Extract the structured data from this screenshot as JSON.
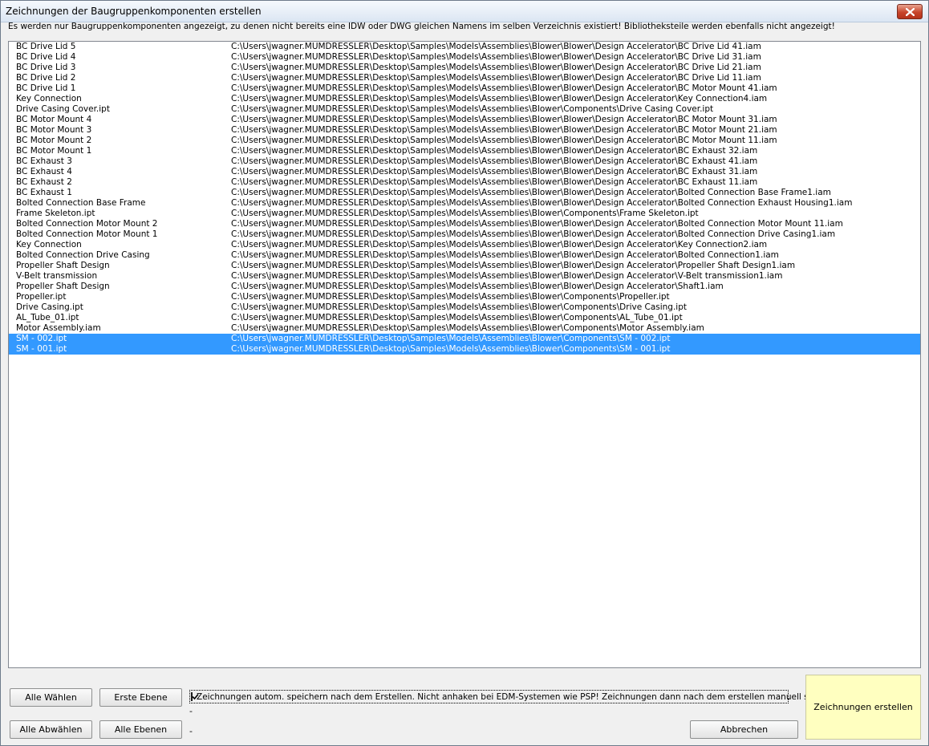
{
  "window": {
    "title": "Zeichnungen der Baugruppenkomponenten erstellen",
    "info": "Es werden nur Baugruppenkomponenten angezeigt, zu denen nicht bereits eine IDW oder DWG gleichen Namens im selben Verzeichnis existiert! Bibliotheksteile werden ebenfalls nicht angezeigt!"
  },
  "list": {
    "rows": [
      {
        "name": "BC Drive Lid 5",
        "path": "C:\\Users\\jwagner.MUMDRESSLER\\Desktop\\Samples\\Models\\Assemblies\\Blower\\Blower\\Design Accelerator\\BC Drive Lid 41.iam",
        "selected": false
      },
      {
        "name": "BC Drive Lid 4",
        "path": "C:\\Users\\jwagner.MUMDRESSLER\\Desktop\\Samples\\Models\\Assemblies\\Blower\\Blower\\Design Accelerator\\BC Drive Lid 31.iam",
        "selected": false
      },
      {
        "name": "BC Drive Lid 3",
        "path": "C:\\Users\\jwagner.MUMDRESSLER\\Desktop\\Samples\\Models\\Assemblies\\Blower\\Blower\\Design Accelerator\\BC Drive Lid 21.iam",
        "selected": false
      },
      {
        "name": "BC Drive Lid 2",
        "path": "C:\\Users\\jwagner.MUMDRESSLER\\Desktop\\Samples\\Models\\Assemblies\\Blower\\Blower\\Design Accelerator\\BC Drive Lid 11.iam",
        "selected": false
      },
      {
        "name": "BC Drive Lid 1",
        "path": "C:\\Users\\jwagner.MUMDRESSLER\\Desktop\\Samples\\Models\\Assemblies\\Blower\\Blower\\Design Accelerator\\BC Motor Mount 41.iam",
        "selected": false
      },
      {
        "name": "Key Connection",
        "path": "C:\\Users\\jwagner.MUMDRESSLER\\Desktop\\Samples\\Models\\Assemblies\\Blower\\Blower\\Design Accelerator\\Key Connection4.iam",
        "selected": false
      },
      {
        "name": "Drive Casing Cover.ipt",
        "path": "C:\\Users\\jwagner.MUMDRESSLER\\Desktop\\Samples\\Models\\Assemblies\\Blower\\Components\\Drive Casing Cover.ipt",
        "selected": false
      },
      {
        "name": "BC Motor Mount 4",
        "path": "C:\\Users\\jwagner.MUMDRESSLER\\Desktop\\Samples\\Models\\Assemblies\\Blower\\Blower\\Design Accelerator\\BC Motor Mount 31.iam",
        "selected": false
      },
      {
        "name": "BC Motor Mount 3",
        "path": "C:\\Users\\jwagner.MUMDRESSLER\\Desktop\\Samples\\Models\\Assemblies\\Blower\\Blower\\Design Accelerator\\BC Motor Mount 21.iam",
        "selected": false
      },
      {
        "name": "BC Motor Mount 2",
        "path": "C:\\Users\\jwagner.MUMDRESSLER\\Desktop\\Samples\\Models\\Assemblies\\Blower\\Blower\\Design Accelerator\\BC Motor Mount 11.iam",
        "selected": false
      },
      {
        "name": "BC Motor Mount 1",
        "path": "C:\\Users\\jwagner.MUMDRESSLER\\Desktop\\Samples\\Models\\Assemblies\\Blower\\Blower\\Design Accelerator\\BC Exhaust 32.iam",
        "selected": false
      },
      {
        "name": "BC Exhaust 3",
        "path": "C:\\Users\\jwagner.MUMDRESSLER\\Desktop\\Samples\\Models\\Assemblies\\Blower\\Blower\\Design Accelerator\\BC Exhaust 41.iam",
        "selected": false
      },
      {
        "name": "BC Exhaust 4",
        "path": "C:\\Users\\jwagner.MUMDRESSLER\\Desktop\\Samples\\Models\\Assemblies\\Blower\\Blower\\Design Accelerator\\BC Exhaust 31.iam",
        "selected": false
      },
      {
        "name": "BC Exhaust 2",
        "path": "C:\\Users\\jwagner.MUMDRESSLER\\Desktop\\Samples\\Models\\Assemblies\\Blower\\Blower\\Design Accelerator\\BC Exhaust 11.iam",
        "selected": false
      },
      {
        "name": "BC Exhaust 1",
        "path": "C:\\Users\\jwagner.MUMDRESSLER\\Desktop\\Samples\\Models\\Assemblies\\Blower\\Blower\\Design Accelerator\\Bolted Connection Base Frame1.iam",
        "selected": false
      },
      {
        "name": "Bolted Connection Base Frame",
        "path": "C:\\Users\\jwagner.MUMDRESSLER\\Desktop\\Samples\\Models\\Assemblies\\Blower\\Blower\\Design Accelerator\\Bolted Connection Exhaust Housing1.iam",
        "selected": false
      },
      {
        "name": "Frame Skeleton.ipt",
        "path": "C:\\Users\\jwagner.MUMDRESSLER\\Desktop\\Samples\\Models\\Assemblies\\Blower\\Components\\Frame Skeleton.ipt",
        "selected": false
      },
      {
        "name": "Bolted Connection Motor Mount 2",
        "path": "C:\\Users\\jwagner.MUMDRESSLER\\Desktop\\Samples\\Models\\Assemblies\\Blower\\Blower\\Design Accelerator\\Bolted Connection Motor Mount 11.iam",
        "selected": false
      },
      {
        "name": "Bolted Connection Motor Mount 1",
        "path": "C:\\Users\\jwagner.MUMDRESSLER\\Desktop\\Samples\\Models\\Assemblies\\Blower\\Blower\\Design Accelerator\\Bolted Connection Drive Casing1.iam",
        "selected": false
      },
      {
        "name": "Key Connection",
        "path": "C:\\Users\\jwagner.MUMDRESSLER\\Desktop\\Samples\\Models\\Assemblies\\Blower\\Blower\\Design Accelerator\\Key Connection2.iam",
        "selected": false
      },
      {
        "name": "Bolted Connection Drive Casing",
        "path": "C:\\Users\\jwagner.MUMDRESSLER\\Desktop\\Samples\\Models\\Assemblies\\Blower\\Blower\\Design Accelerator\\Bolted Connection1.iam",
        "selected": false
      },
      {
        "name": "Propeller Shaft Design",
        "path": "C:\\Users\\jwagner.MUMDRESSLER\\Desktop\\Samples\\Models\\Assemblies\\Blower\\Blower\\Design Accelerator\\Propeller Shaft Design1.iam",
        "selected": false
      },
      {
        "name": "V-Belt transmission",
        "path": "C:\\Users\\jwagner.MUMDRESSLER\\Desktop\\Samples\\Models\\Assemblies\\Blower\\Blower\\Design Accelerator\\V-Belt transmission1.iam",
        "selected": false
      },
      {
        "name": "Propeller Shaft Design",
        "path": "C:\\Users\\jwagner.MUMDRESSLER\\Desktop\\Samples\\Models\\Assemblies\\Blower\\Blower\\Design Accelerator\\Shaft1.iam",
        "selected": false
      },
      {
        "name": "Propeller.ipt",
        "path": "C:\\Users\\jwagner.MUMDRESSLER\\Desktop\\Samples\\Models\\Assemblies\\Blower\\Components\\Propeller.ipt",
        "selected": false
      },
      {
        "name": "Drive Casing.ipt",
        "path": "C:\\Users\\jwagner.MUMDRESSLER\\Desktop\\Samples\\Models\\Assemblies\\Blower\\Components\\Drive Casing.ipt",
        "selected": false
      },
      {
        "name": "AL_Tube_01.ipt",
        "path": "C:\\Users\\jwagner.MUMDRESSLER\\Desktop\\Samples\\Models\\Assemblies\\Blower\\Components\\AL_Tube_01.ipt",
        "selected": false
      },
      {
        "name": "Motor Assembly.iam",
        "path": "C:\\Users\\jwagner.MUMDRESSLER\\Desktop\\Samples\\Models\\Assemblies\\Blower\\Components\\Motor Assembly.iam",
        "selected": false
      },
      {
        "name": "SM - 002.ipt",
        "path": "C:\\Users\\jwagner.MUMDRESSLER\\Desktop\\Samples\\Models\\Assemblies\\Blower\\Components\\SM - 002.ipt",
        "selected": true
      },
      {
        "name": "SM - 001.ipt",
        "path": "C:\\Users\\jwagner.MUMDRESSLER\\Desktop\\Samples\\Models\\Assemblies\\Blower\\Components\\SM - 001.ipt",
        "selected": true
      }
    ]
  },
  "buttons": {
    "select_all": "Alle Wählen",
    "first_level": "Erste Ebene",
    "deselect_all": "Alle Abwählen",
    "all_levels": "Alle Ebenen",
    "cancel": "Abbrechen",
    "create": "Zeichnungen erstellen"
  },
  "options": {
    "autosave_label": "Zeichnungen autom. speichern nach dem Erstellen. Nicht anhaken bei EDM-Systemen wie PSP! Zeichnungen dann nach dem erstellen manuell speichern.",
    "autosave_checked": true,
    "dash_1": "-",
    "dash_2": "-"
  },
  "colors": {
    "selection": "#3399ff",
    "create_button": "#ffffc0",
    "close_button": "#c8452b"
  }
}
